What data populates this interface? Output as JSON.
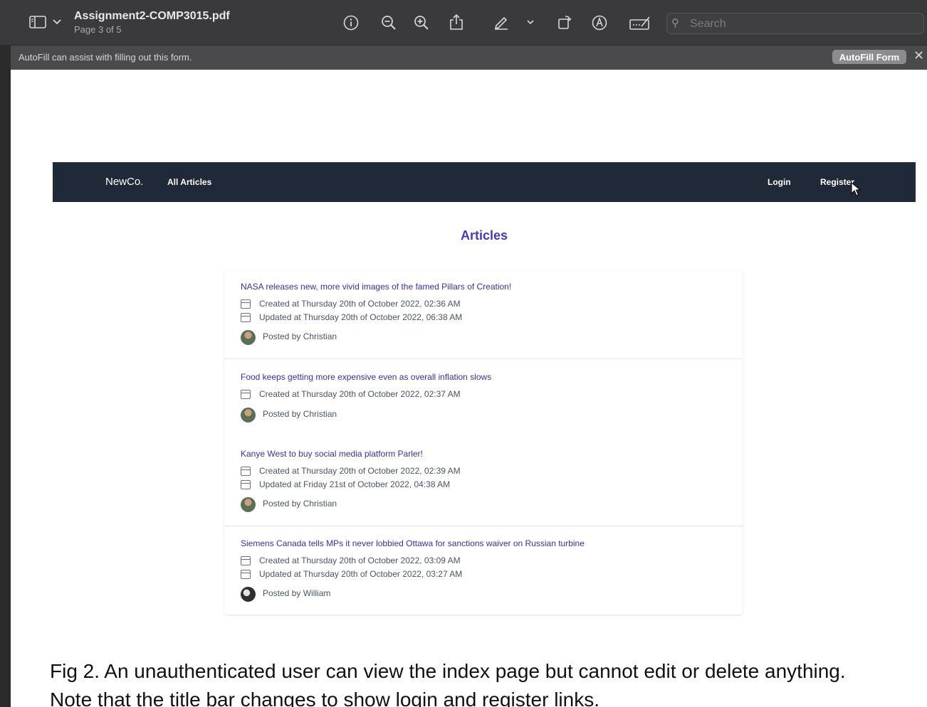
{
  "toolbar": {
    "document_title": "Assignment2-COMP3015.pdf",
    "page_indicator": "Page 3 of 5",
    "search_placeholder": "Search",
    "icons": [
      "sidebar-icon",
      "chevron-down-icon",
      "info-icon",
      "zoom-out-icon",
      "zoom-in-icon",
      "share-icon",
      "markup-pen-icon",
      "chevron-down-icon",
      "rotate-icon",
      "annotate-icon",
      "form-fill-icon",
      "search-icon"
    ]
  },
  "autofill": {
    "message": "AutoFill can assist with filling out this form.",
    "button_label": "AutoFill Form",
    "close_glyph": "✕"
  },
  "site": {
    "brand": "NewCo.",
    "nav_all_articles": "All Articles",
    "nav_login": "Login",
    "nav_register": "Register",
    "heading": "Articles"
  },
  "articles": [
    {
      "title": "NASA releases new, more vivid images of the famed Pillars of Creation!",
      "created": "Created at Thursday 20th of October 2022, 02:36 AM",
      "updated": "Updated at Thursday 20th of October 2022, 06:38 AM",
      "posted_by": "Posted by Christian"
    },
    {
      "title": "Food keeps getting more expensive even as overall inflation slows",
      "created": "Created at Thursday 20th of October 2022, 02:37 AM",
      "posted_by": "Posted by Christian"
    },
    {
      "title": "Kanye West to buy social media platform Parler!",
      "created": "Created at Thursday 20th of October 2022, 02:39 AM",
      "updated": "Updated at Friday 21st of October 2022, 04:38 AM",
      "posted_by": "Posted by Christian"
    },
    {
      "title": "Siemens Canada tells MPs it never lobbied Ottawa for sanctions waiver on Russian turbine",
      "created": "Created at Thursday 20th of October 2022, 03:09 AM",
      "updated": "Updated at Thursday 20th of October 2022, 03:27 AM",
      "posted_by": "Posted by William"
    }
  ],
  "caption": {
    "line1": "Fig 2. An unauthenticated user can view the index page but cannot edit or delete anything.",
    "line2": "Note that the title bar changes to show login and register links."
  }
}
